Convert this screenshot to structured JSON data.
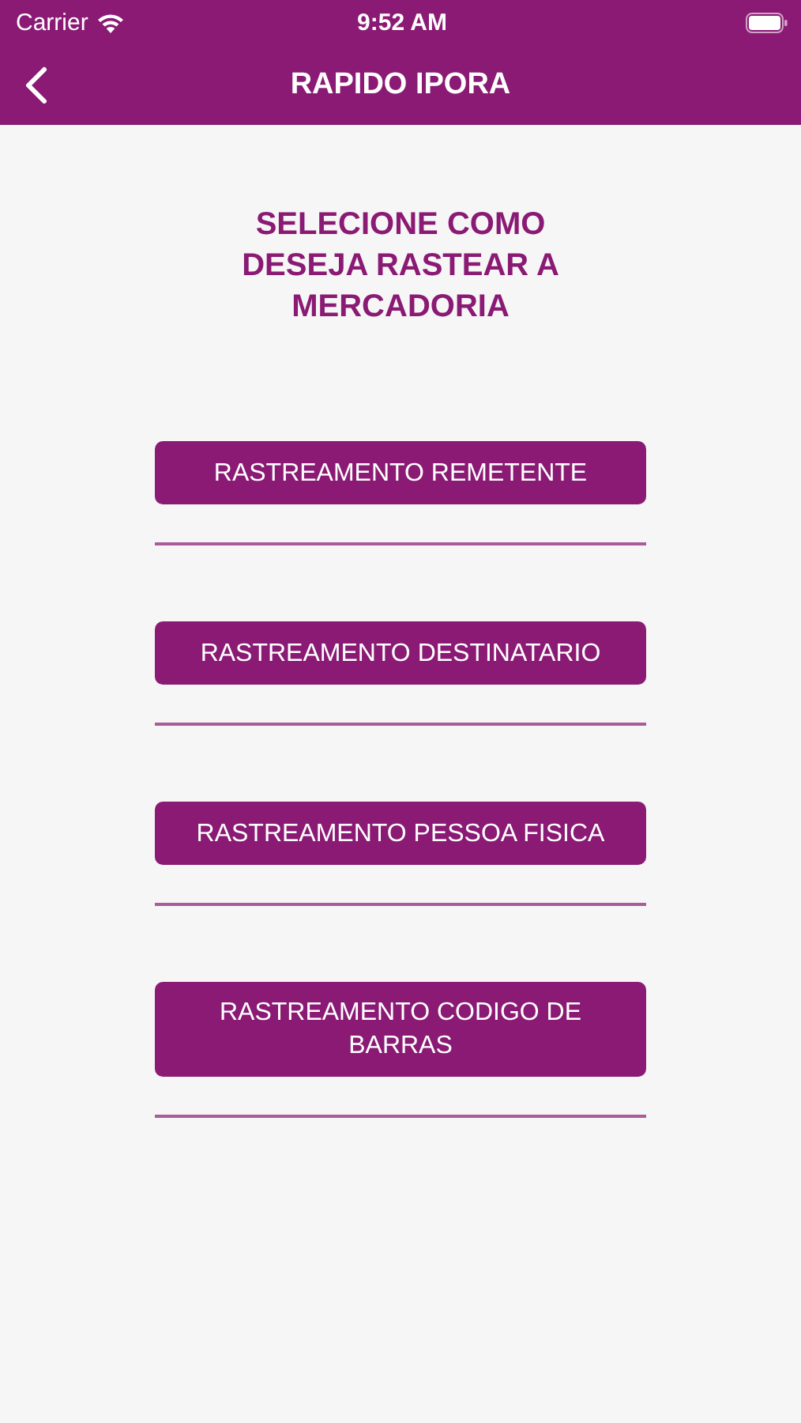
{
  "status_bar": {
    "carrier": "Carrier",
    "time": "9:52 AM"
  },
  "nav_bar": {
    "title": "RAPIDO IPORA"
  },
  "heading": "SELECIONE COMO DESEJA RASTEAR A MERCADORIA",
  "options": [
    {
      "label": "RASTREAMENTO REMETENTE"
    },
    {
      "label": "RASTREAMENTO DESTINATARIO"
    },
    {
      "label": "RASTREAMENTO PESSOA FISICA"
    },
    {
      "label": "RASTREAMENTO CODIGO DE BARRAS"
    }
  ]
}
